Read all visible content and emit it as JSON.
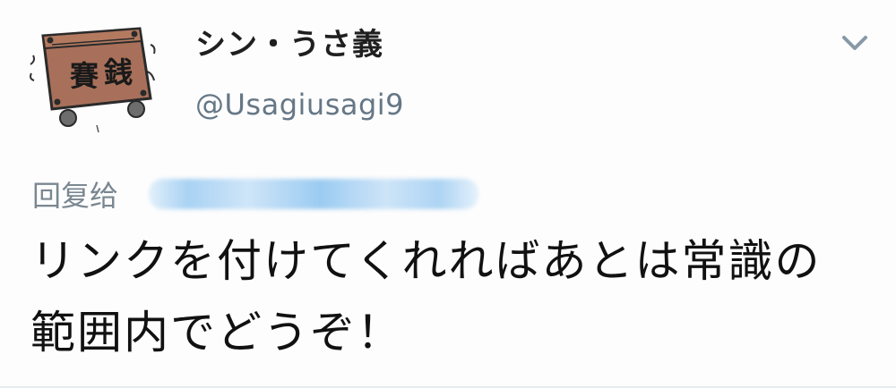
{
  "user": {
    "display_name": "シン・うさ義",
    "handle": "@Usagiusagi9",
    "avatar_icon": "money-box-avatar-icon",
    "avatar_text": "賽銭"
  },
  "menu": {
    "caret_icon": "chevron-down-icon",
    "caret_color": "#8899a6"
  },
  "reply": {
    "label": "回复给",
    "target_redacted": true,
    "target_color": "#8cc3f0"
  },
  "tweet": {
    "text": "リンクを付けてくれればあとは常識の範囲内でどうぞ！"
  },
  "colors": {
    "text_primary": "#111111",
    "text_secondary": "#657786",
    "background": "#fdfdfd"
  }
}
